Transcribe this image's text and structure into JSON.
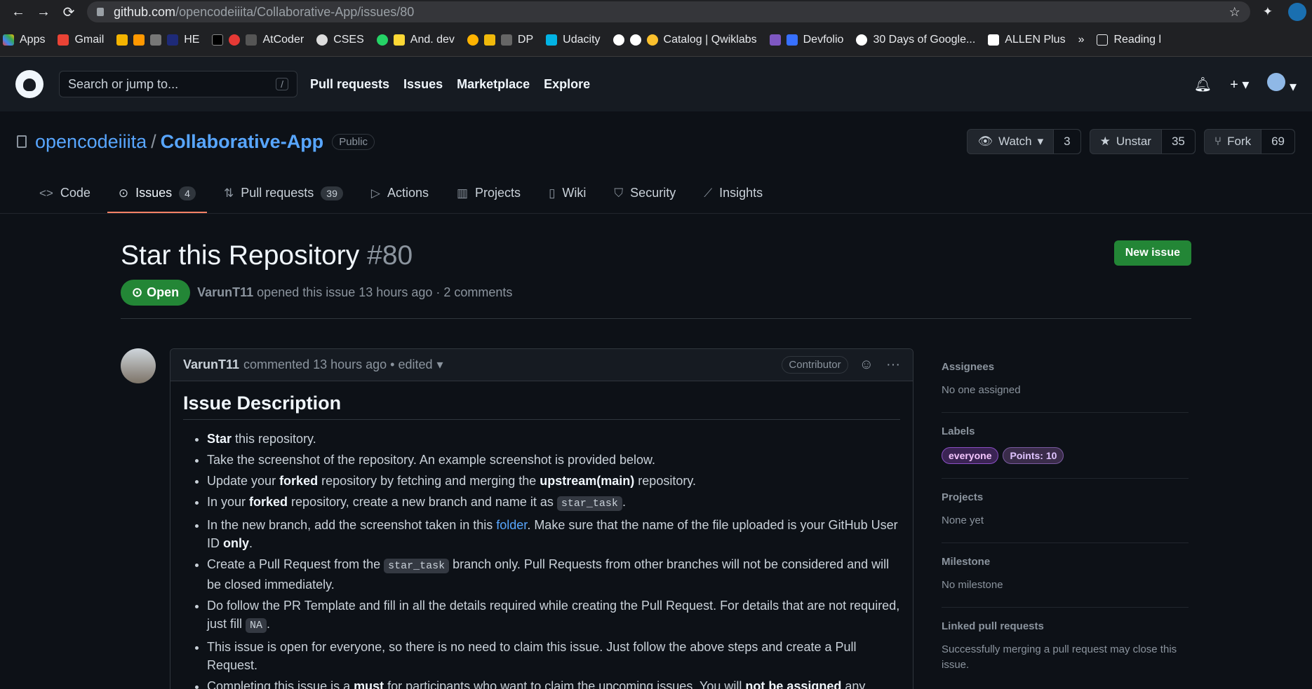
{
  "browser": {
    "url_host": "github.com",
    "url_path": "/opencodeiiita/Collaborative-App/issues/80",
    "bookmarks": [
      "Apps",
      "Gmail",
      "HE",
      "AtCoder",
      "CSES",
      "And. dev",
      "DP",
      "Udacity",
      "Catalog | Qwiklabs",
      "Devfolio",
      "30 Days of Google...",
      "ALLEN Plus",
      "»",
      "Reading l"
    ]
  },
  "header": {
    "search_placeholder": "Search or jump to...",
    "search_key": "/",
    "nav": [
      "Pull requests",
      "Issues",
      "Marketplace",
      "Explore"
    ]
  },
  "repo": {
    "owner": "opencodeiiita",
    "name": "Collaborative-App",
    "visibility": "Public",
    "watch_label": "Watch",
    "watch_count": "3",
    "star_label": "Unstar",
    "star_count": "35",
    "fork_label": "Fork",
    "fork_count": "69"
  },
  "tabs": [
    {
      "label": "Code",
      "icon": "code-icon"
    },
    {
      "label": "Issues",
      "count": "4",
      "icon": "issue-icon"
    },
    {
      "label": "Pull requests",
      "count": "39",
      "icon": "pr-icon"
    },
    {
      "label": "Actions",
      "icon": "play-icon"
    },
    {
      "label": "Projects",
      "icon": "project-icon"
    },
    {
      "label": "Wiki",
      "icon": "book-icon"
    },
    {
      "label": "Security",
      "icon": "shield-icon"
    },
    {
      "label": "Insights",
      "icon": "graph-icon"
    }
  ],
  "issue": {
    "title": "Star this Repository",
    "number": "#80",
    "state": "Open",
    "author": "VarunT11",
    "opened_text": "opened this issue 13 hours ago · 2 comments",
    "new_issue_label": "New issue"
  },
  "comment": {
    "author": "VarunT11",
    "meta": "commented 13 hours ago • edited",
    "role": "Contributor",
    "heading": "Issue Description",
    "items": {
      "i1_b": "Star",
      "i1_t": " this repository.",
      "i2_t": "Take the screenshot of the repository. An example screenshot is provided below.",
      "i3_a": "Update your ",
      "i3_b1": "forked",
      "i3_c": " repository by fetching and merging the ",
      "i3_b2": "upstream(main)",
      "i3_d": " repository.",
      "i4_a": "In your ",
      "i4_b": "forked",
      "i4_c": " repository, create a new branch and name it as ",
      "i4_code": "star_task",
      "i4_d": ".",
      "i5_a": "In the new branch, add the screenshot taken in this ",
      "i5_link": "folder",
      "i5_c": ". Make sure that the name of the file uploaded is your GitHub User ID ",
      "i5_b": "only",
      "i5_d": ".",
      "i6_a": "Create a Pull Request from the ",
      "i6_code": "star_task",
      "i6_c": " branch only. Pull Requests from other branches will not be considered and will be closed immediately.",
      "i7_a": "Do follow the PR Template and fill in all the details required while creating the Pull Request. For details that are not required, just fill ",
      "i7_code": "NA",
      "i7_c": ".",
      "i8_t": "This issue is open for everyone, so there is no need to claim this issue. Just follow the above steps and create a Pull Request.",
      "i9_a": "Completing this issue is a ",
      "i9_b1": "must",
      "i9_c": " for participants who want to claim the upcoming issues. You will ",
      "i9_b2": "not be assigned",
      "i9_d": " any upcoming"
    }
  },
  "sidebar": {
    "assignees_h": "Assignees",
    "assignees_v": "No one assigned",
    "labels_h": "Labels",
    "labels": [
      {
        "text": "everyone",
        "bg": "#3b2454",
        "fg": "#f5c6ff",
        "border": "#8a4fc4"
      },
      {
        "text": "Points: 10",
        "bg": "#3a2c4a",
        "fg": "#e0c4ff",
        "border": "#7a5aa0"
      }
    ],
    "projects_h": "Projects",
    "projects_v": "None yet",
    "milestone_h": "Milestone",
    "milestone_v": "No milestone",
    "linked_h": "Linked pull requests",
    "linked_v": "Successfully merging a pull request may close this issue."
  }
}
